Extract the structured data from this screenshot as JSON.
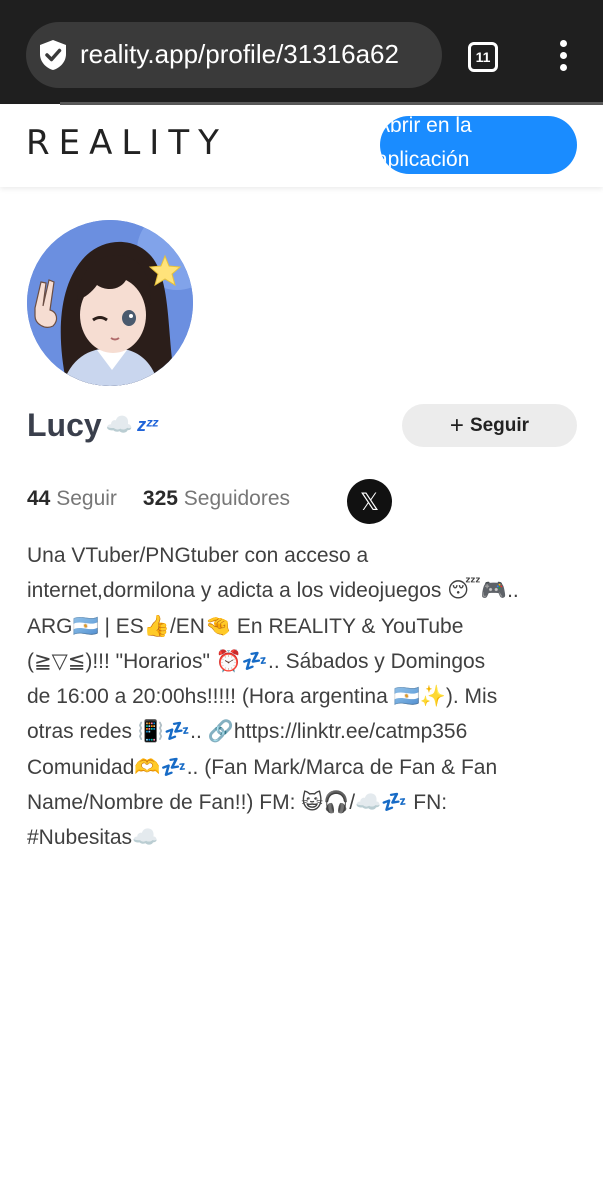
{
  "browser": {
    "url": "reality.app/profile/31316a62",
    "tab_count": "11"
  },
  "header": {
    "logo": "REALITY",
    "open_app_label": "Abrir en la aplicación"
  },
  "profile": {
    "name": "Lucy",
    "name_emoji": "☁️",
    "name_zzz": "zᶻᶻ",
    "follow_label": "Seguir",
    "following_count": "44",
    "following_label": "Seguir",
    "followers_count": "325",
    "followers_label": "Seguidores",
    "social_icon_label": "𝕏",
    "bio": "Una VTuber/PNGtuber con acceso a\ninternet,dormilona y adicta a los videojuegos 😴🎮..\nARG🇦🇷 | ES👍/EN🤏 En REALITY & YouTube\n(≧▽≦)!!! \"Horarios\" ⏰💤.. Sábados y Domingos\nde 16:00 a 20:00hs!!!!! (Hora argentina 🇦🇷✨). Mis\notras redes 📳💤.. 🔗https://linktr.ee/catmp356\nComunidad🫶💤.. (Fan Mark/Marca de Fan & Fan\nName/Nombre de Fan!!) FM: 😺🎧/☁️💤 FN:\n#Nubesitas☁️"
  },
  "colors": {
    "chrome_bg": "#1f1f1f",
    "url_pill": "#3a3a3a",
    "accent_blue": "#1a8cff",
    "follow_bg": "#ececec",
    "name_color": "#3a3f4c"
  }
}
